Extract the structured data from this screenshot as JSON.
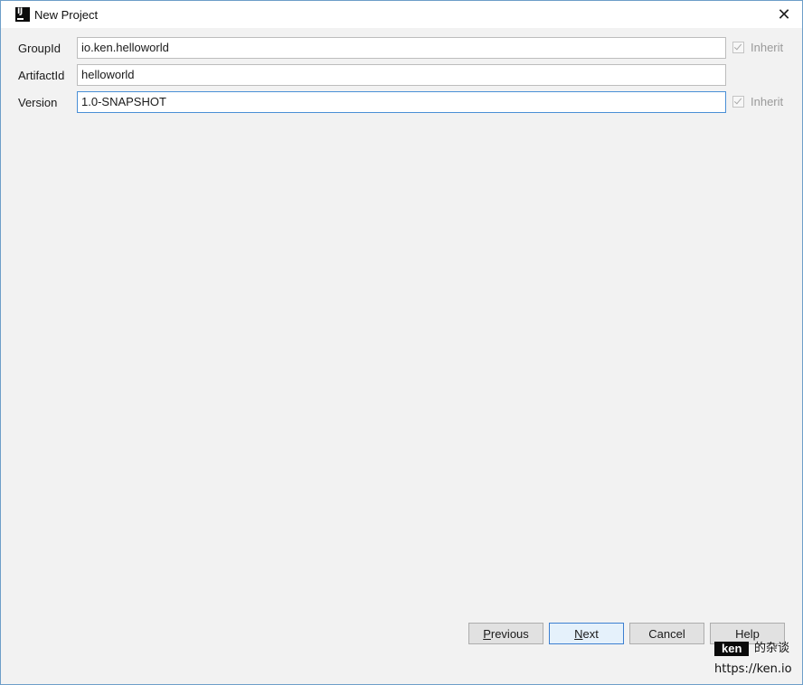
{
  "window": {
    "title": "New Project",
    "close_glyph": "✕"
  },
  "form": {
    "rows": [
      {
        "label": "GroupId",
        "value": "io.ken.helloworld",
        "inherit_label": "Inherit",
        "inherit_checked": true
      },
      {
        "label": "ArtifactId",
        "value": "helloworld"
      },
      {
        "label": "Version",
        "value": "1.0-SNAPSHOT",
        "inherit_label": "Inherit",
        "inherit_checked": true
      }
    ]
  },
  "footer": {
    "previous": {
      "mnemonic": "P",
      "rest": "revious"
    },
    "next": {
      "mnemonic": "N",
      "rest": "ext"
    },
    "cancel": "Cancel",
    "help": "Help"
  },
  "watermark": {
    "brand": "ken",
    "suffix": "的杂谈",
    "url": "https://ken.io"
  },
  "colors": {
    "focus_border": "#4a8fd6",
    "window_border": "#6d9ec9",
    "panel_bg": "#f2f2f2"
  }
}
